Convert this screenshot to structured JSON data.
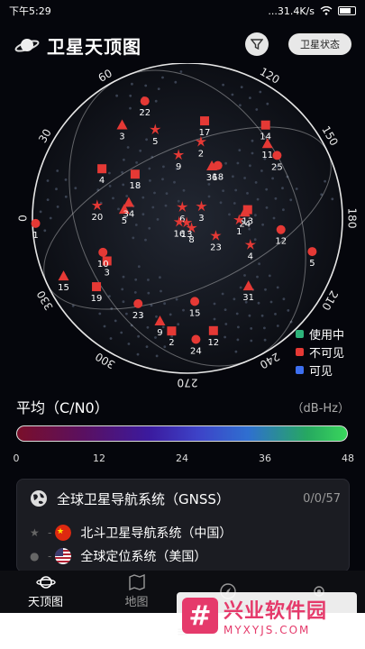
{
  "status_bar": {
    "time": "下午5:29",
    "network": "...31.4K/s"
  },
  "header": {
    "title": "卫星天顶图",
    "status_button": "卫星状态"
  },
  "skyplot": {
    "azimuth_labels": [
      {
        "text": "0",
        "az": 270
      },
      {
        "text": "30",
        "az": 300
      },
      {
        "text": "60",
        "az": 330
      },
      {
        "text": "90",
        "az": 0
      },
      {
        "text": "120",
        "az": 30
      },
      {
        "text": "150",
        "az": 60
      },
      {
        "text": "180",
        "az": 90
      },
      {
        "text": "210",
        "az": 120
      },
      {
        "text": "240",
        "az": 150
      },
      {
        "text": "270",
        "az": 180
      },
      {
        "text": "300",
        "az": 210
      },
      {
        "text": "330",
        "az": 240
      }
    ],
    "satellites": [
      {
        "id": "5",
        "shape": "circle",
        "az": 105,
        "el": 0.15
      },
      {
        "id": "12",
        "shape": "circle",
        "az": 97,
        "el": 0.38
      },
      {
        "id": "4",
        "shape": "star",
        "az": 113,
        "el": 0.55
      },
      {
        "id": "24",
        "shape": "triangle",
        "az": 84,
        "el": 0.62
      },
      {
        "id": "1",
        "shape": "star",
        "az": 92,
        "el": 0.66
      },
      {
        "id": "13",
        "shape": "square",
        "az": 82,
        "el": 0.6
      },
      {
        "id": "25",
        "shape": "circle",
        "az": 55,
        "el": 0.28
      },
      {
        "id": "11",
        "shape": "triangle",
        "az": 47,
        "el": 0.28
      },
      {
        "id": "14",
        "shape": "square",
        "az": 40,
        "el": 0.2
      },
      {
        "id": "31",
        "shape": "triangle",
        "az": 138,
        "el": 0.4
      },
      {
        "id": "23",
        "shape": "star",
        "az": 122,
        "el": 0.78
      },
      {
        "id": "15",
        "shape": "circle",
        "az": 175,
        "el": 0.45
      },
      {
        "id": "12",
        "shape": "square",
        "az": 167,
        "el": 0.24
      },
      {
        "id": "24",
        "shape": "circle",
        "az": 176,
        "el": 0.2
      },
      {
        "id": "8",
        "shape": "star",
        "az": 157,
        "el": 0.93
      },
      {
        "id": "3",
        "shape": "star",
        "az": 50,
        "el": 0.88
      },
      {
        "id": "18",
        "shape": "circle",
        "az": 30,
        "el": 0.6
      },
      {
        "id": "36",
        "shape": "triangle",
        "az": 25,
        "el": 0.62
      },
      {
        "id": "17",
        "shape": "square",
        "az": 10,
        "el": 0.35
      },
      {
        "id": "2",
        "shape": "square",
        "az": 188,
        "el": 0.25
      },
      {
        "id": "9",
        "shape": "triangle",
        "az": 195,
        "el": 0.3
      },
      {
        "id": "13",
        "shape": "star",
        "az": 190,
        "el": 0.97
      },
      {
        "id": "6",
        "shape": "star",
        "az": 335,
        "el": 0.92
      },
      {
        "id": "16",
        "shape": "star",
        "az": 245,
        "el": 0.94
      },
      {
        "id": "9",
        "shape": "star",
        "az": 352,
        "el": 0.58
      },
      {
        "id": "2",
        "shape": "star",
        "az": 10,
        "el": 0.49
      },
      {
        "id": "23",
        "shape": "circle",
        "az": 210,
        "el": 0.35
      },
      {
        "id": "5",
        "shape": "triangle",
        "az": 278,
        "el": 0.58
      },
      {
        "id": "5",
        "shape": "star",
        "az": 340,
        "el": 0.38
      },
      {
        "id": "34",
        "shape": "triangle",
        "az": 285,
        "el": 0.6
      },
      {
        "id": "18",
        "shape": "square",
        "az": 310,
        "el": 0.55
      },
      {
        "id": "22",
        "shape": "circle",
        "az": 340,
        "el": 0.18
      },
      {
        "id": "3",
        "shape": "triangle",
        "az": 325,
        "el": 0.25
      },
      {
        "id": "3",
        "shape": "square",
        "az": 242,
        "el": 0.4
      },
      {
        "id": "10",
        "shape": "circle",
        "az": 248,
        "el": 0.4
      },
      {
        "id": "19",
        "shape": "square",
        "az": 233,
        "el": 0.25
      },
      {
        "id": "20",
        "shape": "star",
        "az": 278,
        "el": 0.4
      },
      {
        "id": "4",
        "shape": "square",
        "az": 300,
        "el": 0.35
      },
      {
        "id": "15",
        "shape": "triangle",
        "az": 245,
        "el": 0.1
      },
      {
        "id": "1",
        "shape": "circle",
        "az": 268,
        "el": 0.0
      }
    ]
  },
  "legend": [
    {
      "label": "使用中",
      "color": "#2db37a"
    },
    {
      "label": "不可见",
      "color": "#e53935"
    },
    {
      "label": "可见",
      "color": "#3d6ff0"
    }
  ],
  "cn0": {
    "title": "平均（C/N0）",
    "unit": "（dB-Hz）",
    "ticks": [
      "0",
      "12",
      "24",
      "36",
      "48"
    ]
  },
  "gnss": {
    "title": "全球卫星导航系统（GNSS）",
    "count": "0/0/57",
    "systems": [
      {
        "name": "北斗卫星导航系统（中国）"
      },
      {
        "name": "全球定位系统（美国）"
      }
    ]
  },
  "bottom_nav": [
    {
      "label": "天顶图"
    },
    {
      "label": "地图"
    },
    {
      "label": ""
    },
    {
      "label": ""
    }
  ],
  "watermark": {
    "title": "兴业软件园",
    "sub": "MYXYJS.COM"
  },
  "colors": {
    "satellite": "#e53935",
    "accent": "#3d6ff0"
  }
}
